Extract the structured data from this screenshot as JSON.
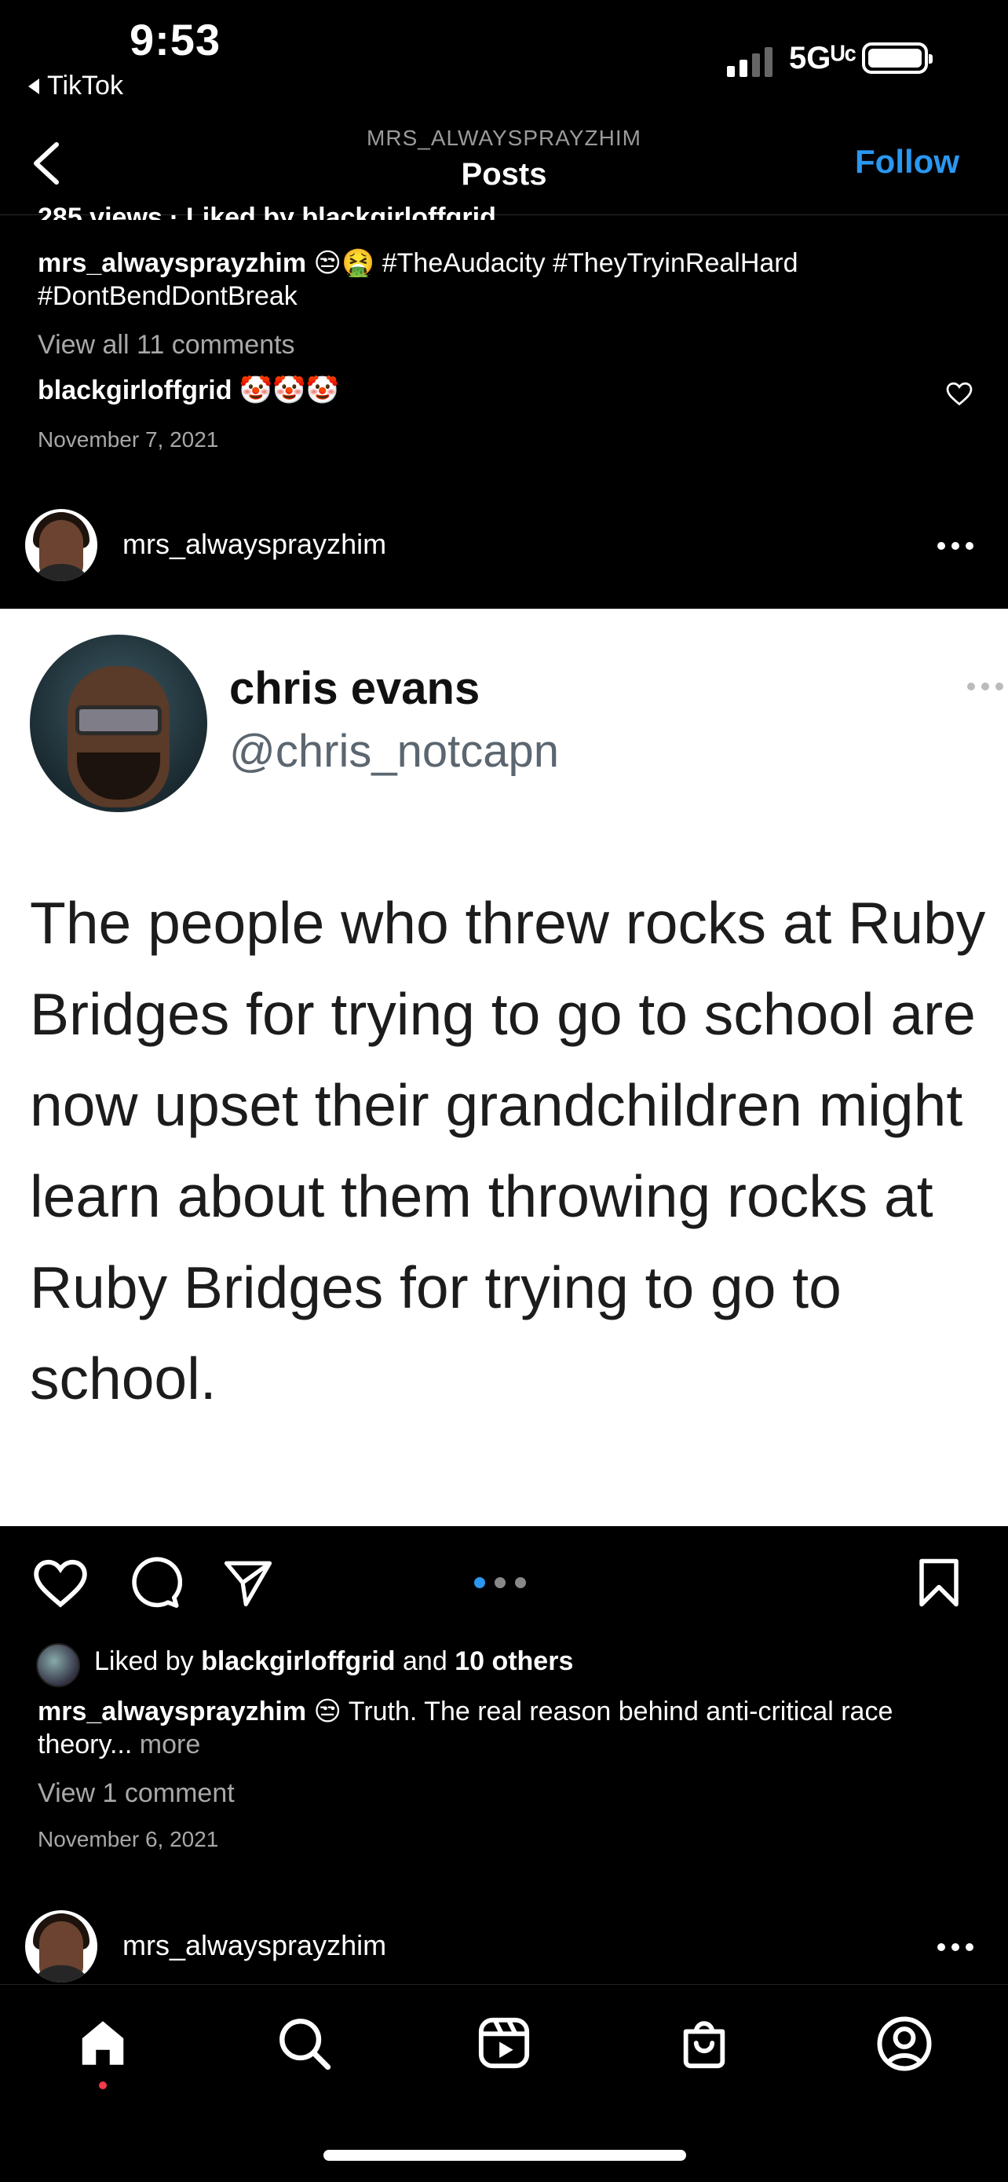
{
  "status_bar": {
    "time": "9:53",
    "back_app": "TikTok",
    "network": "5Gᵁᶜ"
  },
  "header": {
    "subtitle": "MRS_ALWAYSPRAYZHIM",
    "title": "Posts",
    "follow_label": "Follow"
  },
  "prev_post": {
    "likes_partial": "285 views · Liked by blackgirloffgrid",
    "username": "mrs_alwaysprayzhim",
    "caption": "😒🤮 #TheAudacity #TheyTryinRealHard #DontBendDontBreak",
    "view_comments": "View all 11 comments",
    "comment_user": "blackgirloffgrid",
    "comment_text": "🤡🤡🤡",
    "date": "November 7, 2021"
  },
  "post": {
    "username": "mrs_alwaysprayzhim",
    "tweet": {
      "name": "chris evans",
      "handle": "@chris_notcapn",
      "body": "The people who threw rocks at Ruby Bridges for trying to go to school are now upset their grandchildren might learn about them throwing rocks at Ruby Bridges for trying to go to school."
    },
    "liked_prefix": "Liked by ",
    "liked_user": "blackgirloffgrid",
    "liked_mid": " and ",
    "liked_others": "10 others",
    "caption_user": "mrs_alwaysprayzhim",
    "caption_text": "😒 Truth. The real reason behind anti-critical race theory...",
    "more_label": "more",
    "view_comments": "View 1 comment",
    "date": "November 6, 2021"
  },
  "next_post": {
    "username": "mrs_alwaysprayzhim"
  },
  "bottom_nav": [
    "home-icon",
    "search-icon",
    "reels-icon",
    "shop-icon",
    "profile-icon"
  ],
  "colors": {
    "accent": "#2a97f0",
    "background": "#000000",
    "notification": "#f2394d"
  }
}
